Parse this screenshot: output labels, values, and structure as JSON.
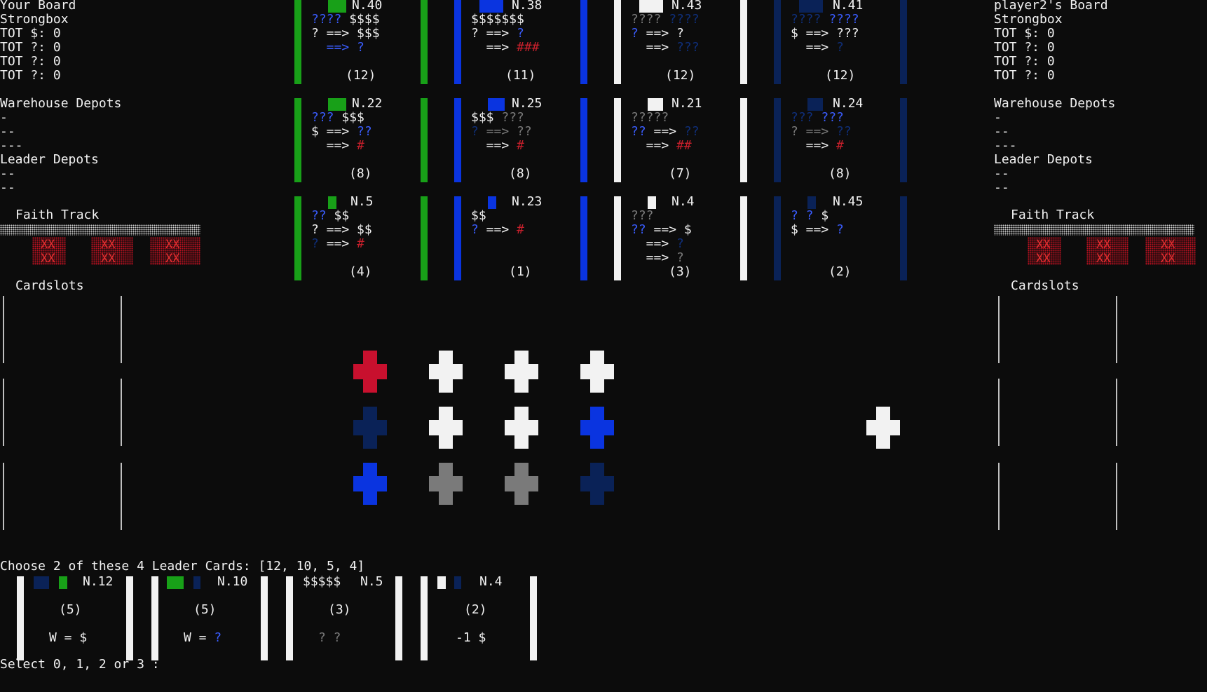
{
  "colors": {
    "green": "#18a018",
    "blue": "#0a34e0",
    "white": "#f2f2f2",
    "navy": "#0a2257",
    "red": "#c8102e",
    "gray": "#7a7a7a",
    "brightblue": "#3a5dff"
  },
  "your_board": {
    "title": "Your Board",
    "strongbox": "Strongbox",
    "tot_coin": "TOT $: 0",
    "tot_servant": "TOT ?: 0",
    "tot_stone": "TOT ?: 0",
    "tot_shield": "TOT ?: 0",
    "warehouse": "Warehouse Depots",
    "wd1": "-",
    "wd2": "--",
    "wd3": "---",
    "leader_depots": "Leader Depots",
    "ld1": "--",
    "ld2": "--",
    "faith": "Faith Track",
    "xx": "XX",
    "cardslots": "Cardslots"
  },
  "p2_board": {
    "title": "player2's Board",
    "strongbox": "Strongbox",
    "tot_coin": "TOT $: 0",
    "tot_servant": "TOT ?: 0",
    "tot_stone": "TOT ?: 0",
    "tot_shield": "TOT ?: 0",
    "warehouse": "Warehouse Depots",
    "wd1": "-",
    "wd2": "--",
    "wd3": "---",
    "leader_depots": "Leader Depots",
    "ld1": "--",
    "ld2": "--",
    "faith": "Faith Track",
    "xx": "XX",
    "cardslots": "Cardslots"
  },
  "dev_cards": {
    "c40": {
      "id": "N.40",
      "l1a": "????",
      "l1b": " $$$$",
      "l2": "? ==> $$$",
      "l3": "  ==> ?",
      "vp": "(12)"
    },
    "c38": {
      "id": "N.38",
      "l1": "$$$$$$$",
      "l2a": "? ==> ",
      "l2b": "?",
      "l3a": "  ==> ",
      "l3b": "###",
      "vp": "(11)"
    },
    "c43": {
      "id": "N.43",
      "l1a": "???? ",
      "l1b": "????",
      "l2a": "?",
      "l2b": " ==> ?",
      "l3a": "  ==> ",
      "l3b": "???",
      "vp": "(12)"
    },
    "c41": {
      "id": "N.41",
      "l1a": "????",
      "l1b": " ????",
      "l2": "$ ==> ???",
      "l3a": "  ==> ",
      "l3b": "?",
      "vp": "(12)"
    },
    "c22": {
      "id": "N.22",
      "l1a": "???",
      "l1b": " $$$",
      "l2a": "$ ==> ",
      "l2b": "??",
      "l3a": "  ==> ",
      "l3b": "#",
      "vp": "(8)"
    },
    "c25": {
      "id": "N.25",
      "l1a": "$$$",
      "l1b": " ???",
      "l2a": "? ",
      "l2b": "==> ??",
      "l3a": "  ==> ",
      "l3b": "#",
      "vp": "(8)"
    },
    "c21": {
      "id": "N.21",
      "l1": "?????",
      "l2a": "??",
      "l2b": " ==> ",
      "l2c": "??",
      "l3a": "  ==> ",
      "l3b": "##",
      "vp": "(7)"
    },
    "c24": {
      "id": "N.24",
      "l1a": "???",
      "l1b": " ???",
      "l2a": "? ==> ",
      "l2b": "??",
      "l3a": "  ==> ",
      "l3b": "#",
      "vp": "(8)"
    },
    "c5": {
      "id": "N.5",
      "l1a": "??",
      "l1b": " $$",
      "l2": "? ==> $$",
      "l3a": "? ",
      "l3b": "==> ",
      "l3c": "#",
      "vp": "(4)"
    },
    "c23": {
      "id": "N.23",
      "l1": "$$",
      "l2a": "?",
      "l2b": " ==> ",
      "l2c": "#",
      "vp": "(1)"
    },
    "c4": {
      "id": "N.4",
      "l1": "???",
      "l2a": "??",
      "l2b": " ==> $",
      "l3a": "  ==> ",
      "l3b": "?",
      "l4a": "  ==> ",
      "l4b": "?",
      "vp": "(3)"
    },
    "c45": {
      "id": "N.45",
      "l1a": "? ? ",
      "l1b": "$",
      "l2a": "$ ==> ",
      "l2b": "?",
      "vp": "(2)"
    }
  },
  "market": {
    "rows": [
      [
        "red",
        "white",
        "white",
        "white"
      ],
      [
        "navy",
        "white",
        "white",
        "blue"
      ],
      [
        "blue",
        "gray",
        "gray",
        "navy"
      ]
    ],
    "extra": "white"
  },
  "leader_prompt": "Choose 2 of these 4 Leader Cards: [12, 10, 5, 4]",
  "leaders": [
    {
      "id": "N.12",
      "vp": "(5)",
      "ability": "W = $"
    },
    {
      "id": "N.10",
      "vp": "(5)",
      "ability_a": "W = ",
      "ability_b": "?"
    },
    {
      "req": "$$$$$",
      "id": "N.5",
      "vp": "(3)",
      "ability": "? ?"
    },
    {
      "id": "N.4",
      "vp": "(2)",
      "ability": "-1 $"
    }
  ],
  "select_prompt": "Select 0, 1, 2 or 3 :"
}
